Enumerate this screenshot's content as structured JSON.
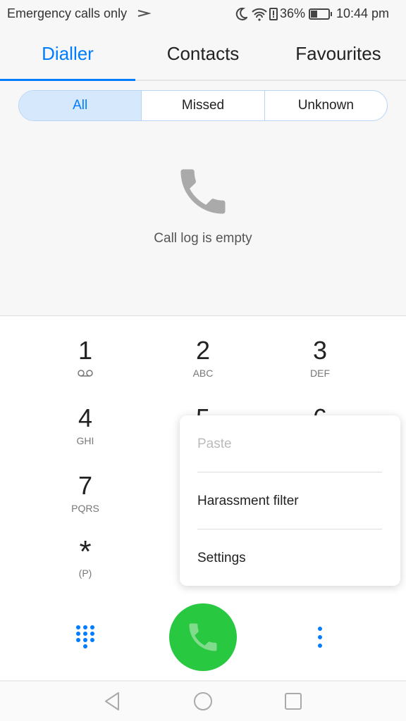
{
  "status": {
    "carrier": "Emergency calls only",
    "battery": "36%",
    "time": "10:44 pm"
  },
  "tabs": [
    {
      "label": "Dialler"
    },
    {
      "label": "Contacts"
    },
    {
      "label": "Favourites"
    }
  ],
  "filters": [
    "All",
    "Missed",
    "Unknown"
  ],
  "empty_text": "Call log is empty",
  "keys": [
    {
      "d": "1",
      "l": ""
    },
    {
      "d": "2",
      "l": "ABC"
    },
    {
      "d": "3",
      "l": "DEF"
    },
    {
      "d": "4",
      "l": "GHI"
    },
    {
      "d": "5",
      "l": ""
    },
    {
      "d": "6",
      "l": ""
    },
    {
      "d": "7",
      "l": "PQRS"
    },
    {
      "d": "*",
      "l": "(P)"
    }
  ],
  "menu": {
    "paste": "Paste",
    "harassment": "Harassment filter",
    "settings": "Settings"
  },
  "colors": {
    "accent": "#007dff",
    "call": "#28c840"
  }
}
